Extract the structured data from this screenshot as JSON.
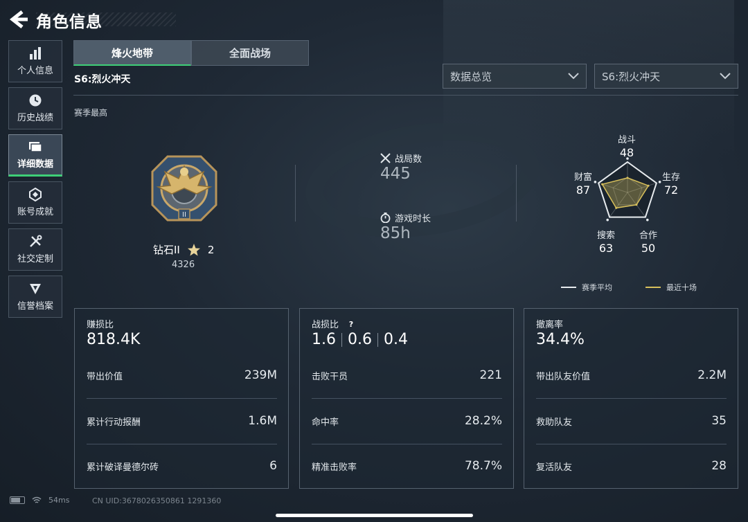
{
  "header": {
    "title": "角色信息"
  },
  "sidebar": {
    "items": [
      {
        "label": "个人信息",
        "icon": "bar-chart-icon",
        "active": false
      },
      {
        "label": "历史战绩",
        "icon": "clock-icon",
        "active": false
      },
      {
        "label": "详细数据",
        "icon": "folder-icon",
        "active": true
      },
      {
        "label": "账号成就",
        "icon": "achievement-icon",
        "active": false
      },
      {
        "label": "社交定制",
        "icon": "tools-icon",
        "active": false
      },
      {
        "label": "信誉档案",
        "icon": "shield-icon",
        "active": false
      }
    ]
  },
  "tabs": [
    {
      "label": "烽火地带",
      "active": true
    },
    {
      "label": "全面战场",
      "active": false
    }
  ],
  "season": {
    "label": "S6:烈火冲天"
  },
  "filters": {
    "view": "数据总览",
    "season": "S6:烈火冲天"
  },
  "season_best": {
    "label": "赛季最高"
  },
  "rank": {
    "name": "钻石II",
    "stars": "2",
    "score": "4326"
  },
  "overview": {
    "matches_label": "战局数",
    "matches_value": "445",
    "playtime_label": "游戏时长",
    "playtime_value": "85h"
  },
  "radar": {
    "axes": [
      {
        "label": "战斗",
        "value": "48"
      },
      {
        "label": "生存",
        "value": "72"
      },
      {
        "label": "合作",
        "value": "50"
      },
      {
        "label": "搜索",
        "value": "63"
      },
      {
        "label": "财富",
        "value": "87"
      }
    ],
    "legend": {
      "season_avg": "赛季平均",
      "recent_ten": "最近十场"
    },
    "colors": {
      "season_avg": "#e8ecef",
      "recent_ten": "#d8c05c"
    }
  },
  "cards": {
    "profit": {
      "title": "赚损比",
      "value": "818.4K",
      "rows": [
        {
          "label": "带出价值",
          "value": "239M"
        },
        {
          "label": "累计行动报酬",
          "value": "1.6M"
        },
        {
          "label": "累计破译曼德尔砖",
          "value": "6"
        }
      ]
    },
    "combat": {
      "title": "战损比",
      "help": "?",
      "values": [
        "1.6",
        "0.6",
        "0.4"
      ],
      "rows": [
        {
          "label": "击败干员",
          "value": "221"
        },
        {
          "label": "命中率",
          "value": "28.2%"
        },
        {
          "label": "精准击败率",
          "value": "78.7%"
        }
      ]
    },
    "extract": {
      "title": "撤离率",
      "value": "34.4%",
      "rows": [
        {
          "label": "带出队友价值",
          "value": "2.2M"
        },
        {
          "label": "救助队友",
          "value": "35"
        },
        {
          "label": "复活队友",
          "value": "28"
        }
      ]
    }
  },
  "status": {
    "ping": "54ms",
    "uid": "CN UID:3678026350861 1291360"
  },
  "accent": "#3ed078"
}
